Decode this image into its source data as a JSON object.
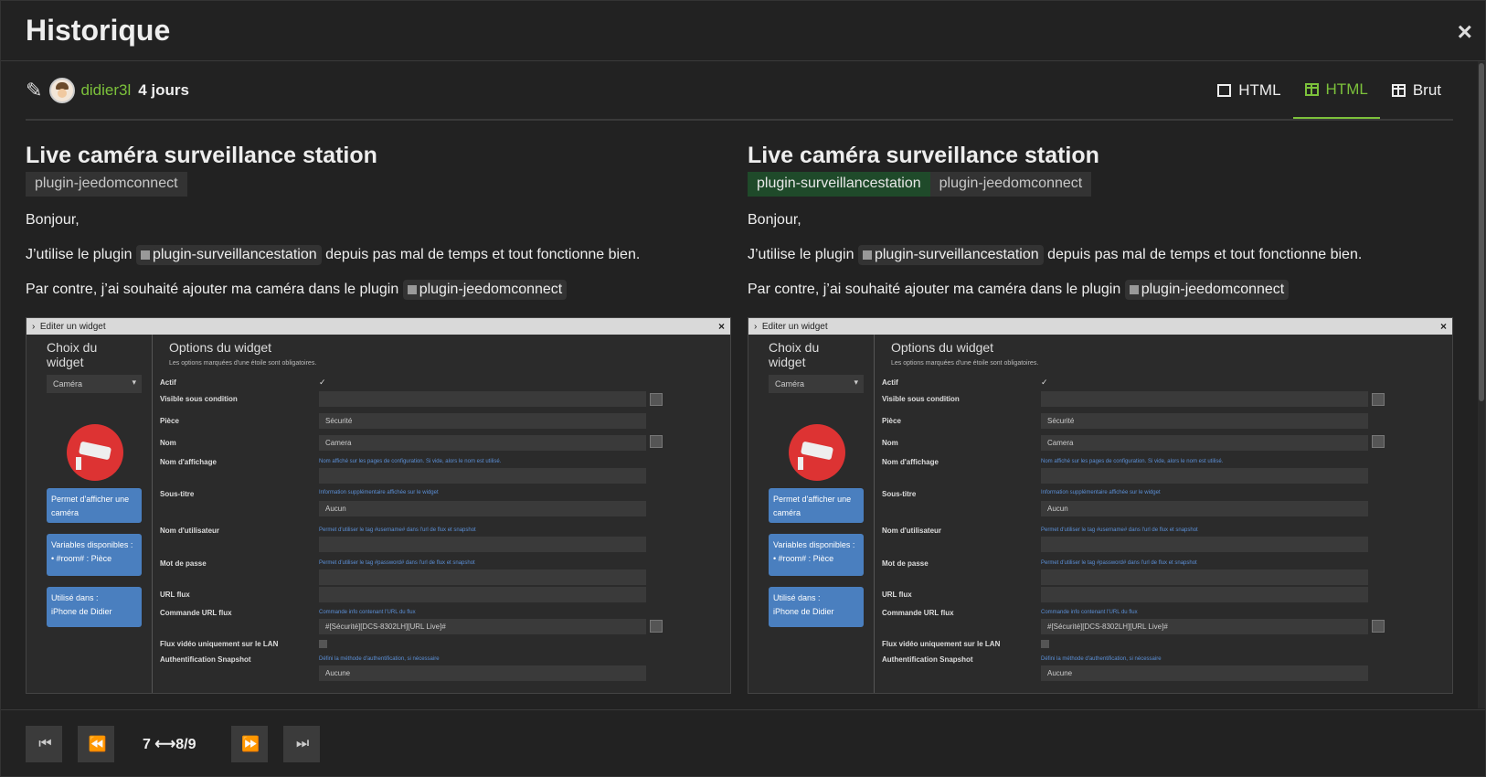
{
  "window": {
    "title": "Historique",
    "close_label": "×"
  },
  "meta": {
    "username": "didier3l",
    "age": "4 jours",
    "modes": [
      {
        "label": "HTML",
        "icon": "square-icon",
        "active": false
      },
      {
        "label": "HTML",
        "icon": "split-columns-icon",
        "active": true
      },
      {
        "label": "Brut",
        "icon": "split-columns-icon",
        "active": false
      }
    ]
  },
  "left": {
    "title": "Live caméra surveillance station",
    "tags": [
      "plugin-jeedomconnect"
    ]
  },
  "right": {
    "title": "Live caméra surveillance station",
    "tags": [
      "plugin-surveillancestation",
      "plugin-jeedomconnect"
    ]
  },
  "post": {
    "greeting": "Bonjour,",
    "line1_prefix": "J’utilise le plugin",
    "line1_mention": "plugin-surveillancestation",
    "line1_suffix": "depuis pas mal de temps et tout fonctionne bien.",
    "line2_prefix": "Par contre, j’ai souhaité ajouter ma caméra dans le plugin",
    "line2_mention": "plugin-jeedomconnect"
  },
  "screenshot": {
    "bar_title": "Editer un widget",
    "left_heading": "Choix du widget",
    "select_value": "Caméra",
    "card1": "Permet d'afficher une caméra",
    "card2_title": "Variables disponibles :",
    "card2_item": "#room# : Pièce",
    "card3_title": "Utilisé dans :",
    "card3_item": "iPhone de Didier",
    "right_heading": "Options du widget",
    "right_sub": "Les options marquées d'une étoile sont obligatoires.",
    "fields": {
      "actif": "Actif",
      "visible": "Visible sous condition",
      "piece": "Pièce",
      "piece_value": "Sécurité",
      "nom": "Nom",
      "nom_value": "Camera",
      "affichage": "Nom d'affichage",
      "affichage_help": "Nom affiché sur les pages de configuration. Si vide, alors le nom est utilisé.",
      "soustitre": "Sous-titre",
      "soustitre_help": "Information supplémentaire affichée sur le widget",
      "soustitre_value": "Aucun",
      "user": "Nom d'utilisateur",
      "user_help": "Permet d'utiliser le tag #username# dans l'url de flux et snapshot",
      "pass": "Mot de passe",
      "pass_help": "Permet d'utiliser le tag #password# dans l'url de flux et snapshot",
      "url": "URL flux",
      "cmd": "Commande URL flux",
      "cmd_help": "Commande info contenant l'URL du flux",
      "cmd_value": "#[Sécurité][DCS-8302LH][URL Live]#",
      "lan": "Flux vidéo uniquement sur le LAN",
      "auth": "Authentification Snapshot",
      "auth_help": "Défini la méthode d'authentification, si nécessaire",
      "auth_value": "Aucune"
    }
  },
  "pager": {
    "position": "7 ⟷8/9"
  }
}
